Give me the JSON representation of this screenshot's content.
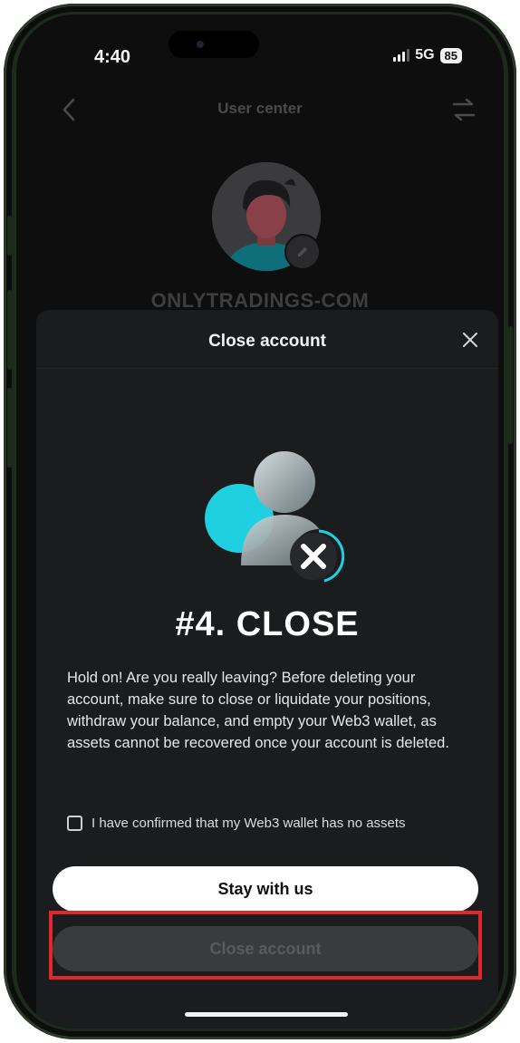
{
  "status_bar": {
    "time": "4:40",
    "network": "5G",
    "battery": "85"
  },
  "header": {
    "title": "User center",
    "back_icon": "chevron-left-icon",
    "swap_icon": "swap-arrows-icon"
  },
  "profile": {
    "username": "ONLYTRADINGS-COM",
    "edit_icon": "pencil-icon"
  },
  "sheet": {
    "title": "Close account",
    "close_icon": "close-icon",
    "illustration_icon": "remove-user-icon",
    "headline": "#4. CLOSE",
    "warning": "Hold on! Are you really leaving? Before deleting your account, make sure to close or liquidate your positions, withdraw your balance, and empty your Web3 wallet, as assets cannot be recovered once your account is deleted.",
    "confirm_checkbox": {
      "label": "I have confirmed that my Web3 wallet has no assets",
      "checked": false
    },
    "stay_button": "Stay with us",
    "close_button": "Close account",
    "close_button_enabled": false
  },
  "colors": {
    "accent_cyan": "#1fd0e0",
    "highlight_red": "#e0272c",
    "sheet_bg": "#1b1c1e"
  }
}
